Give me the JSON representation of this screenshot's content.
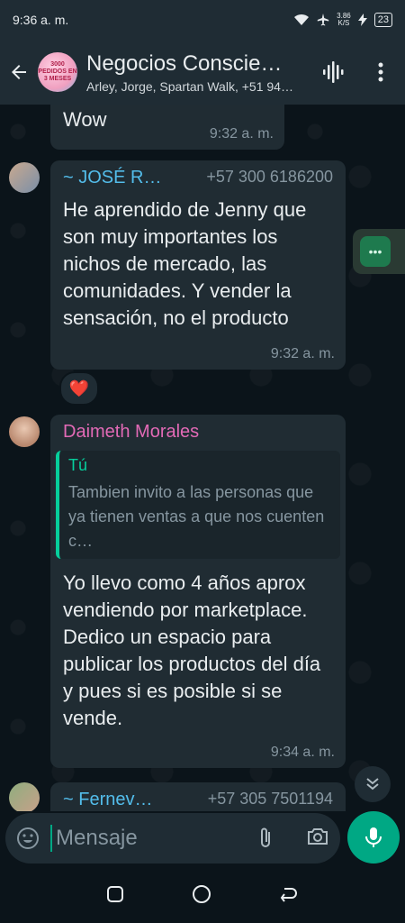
{
  "status_bar": {
    "time": "9:36 a. m.",
    "speed": "3.86",
    "speed_unit": "K/S",
    "battery": "23"
  },
  "header": {
    "title": "Negocios Conscie…",
    "subtitle": "Arley, Jorge, Spartan Walk, +51 94…",
    "avatar_text": "3000 PEDIDOS EN 3 MESES"
  },
  "messages": [
    {
      "text": "Wow",
      "time": "9:32 a. m."
    },
    {
      "sender": "~ JOSÉ R…",
      "phone": "+57 300 6186200",
      "text": "He aprendido de Jenny que son muy importantes los nichos de mercado, las comunidades. Y vender la sensación, no el producto",
      "time": "9:32 a. m.",
      "reaction": "❤️"
    },
    {
      "sender": "Daimeth Morales",
      "quote_author": "Tú",
      "quote_text": "Tambien invito a las personas que ya tienen ventas a que nos cuenten c…",
      "text": "Yo llevo como 4 años aprox vendiendo por marketplace. Dedico un espacio para publicar los productos del día y pues si es posible si se vende.",
      "time": "9:34 a. m."
    },
    {
      "sender": "~ Fernev…",
      "phone": "+57 305 7501194"
    }
  ],
  "composer": {
    "placeholder": "Mensaje"
  },
  "colors": {
    "bg": "#0b141a",
    "bubble": "#202c33",
    "accent": "#00a884",
    "sender_jose": "#53bdeb",
    "sender_daimeth": "#e26ab6",
    "sender_fernev": "#53bdeb"
  },
  "icons": [
    "back-arrow-icon",
    "voice-wave-icon",
    "more-vert-icon",
    "emoji-icon",
    "attach-icon",
    "camera-icon",
    "mic-icon",
    "chevron-down-double-icon"
  ]
}
